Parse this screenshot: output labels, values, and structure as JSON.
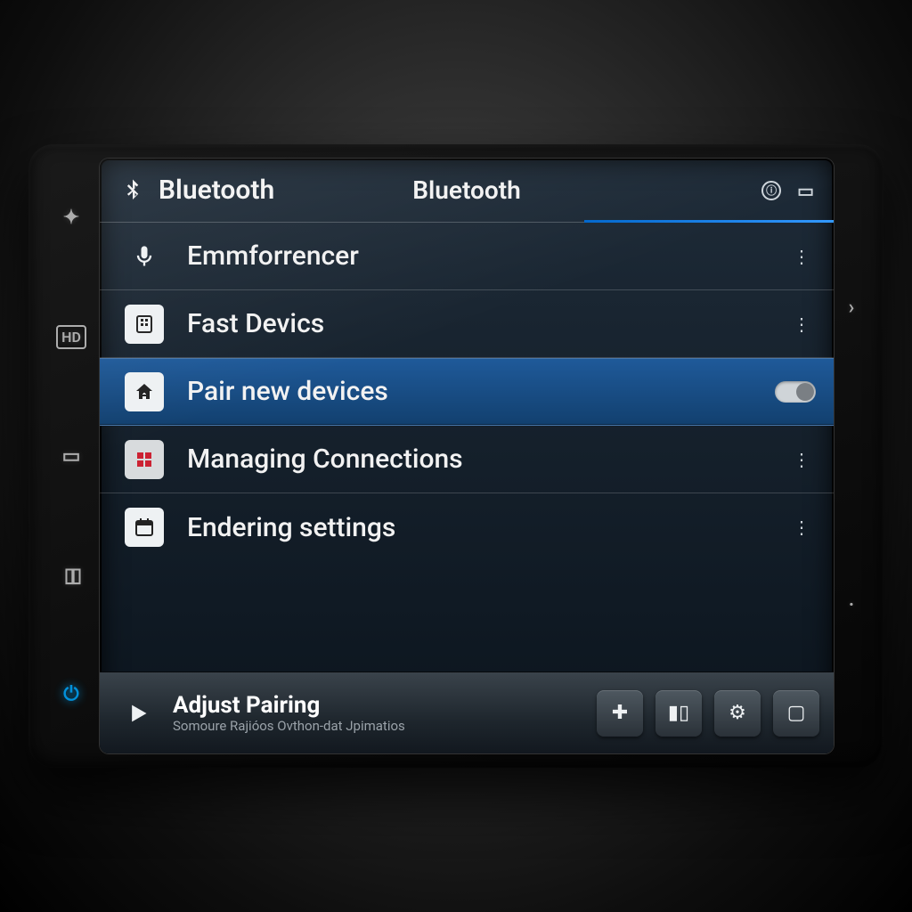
{
  "titlebar": {
    "left_label": "Bluetooth",
    "center_label": "Bluetooth"
  },
  "menu": [
    {
      "icon": "mic",
      "label": "Emmforrencer",
      "trailing": "more"
    },
    {
      "icon": "device",
      "label": "Fast Devics",
      "trailing": "more"
    },
    {
      "icon": "home",
      "label": "Pair new devices",
      "trailing": "toggle",
      "selected": true
    },
    {
      "icon": "grid",
      "label": "Managing Connections",
      "trailing": "more"
    },
    {
      "icon": "calendar",
      "label": "Endering settings",
      "trailing": "more"
    }
  ],
  "bottombar": {
    "title": "Adjust Pairing",
    "subtitle": "Somoure Rajióos Ovthon-dat Jpimatios"
  }
}
